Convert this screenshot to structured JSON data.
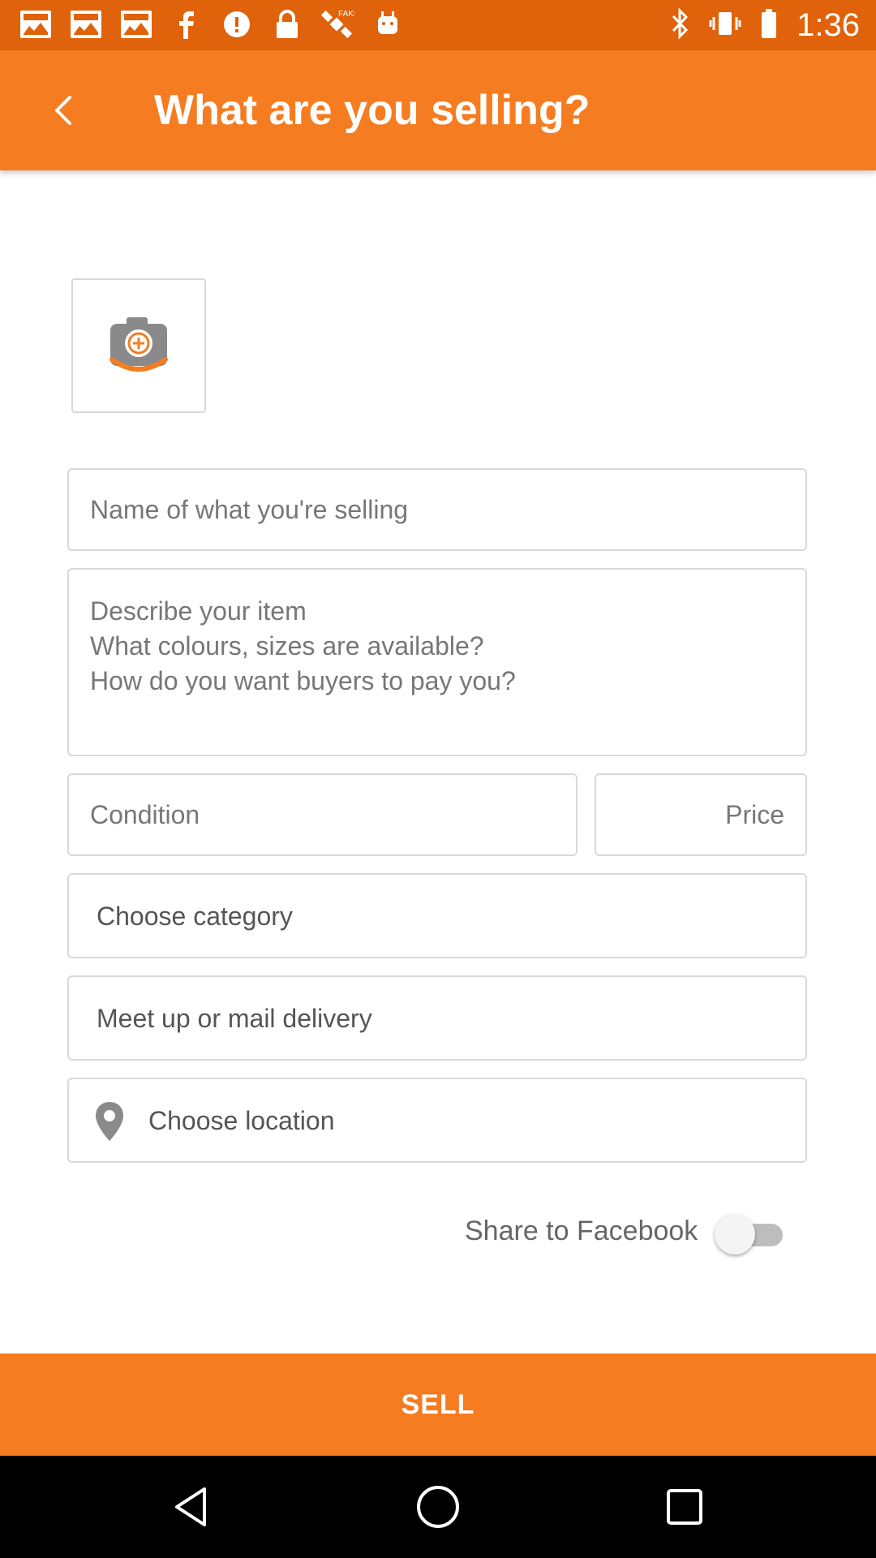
{
  "status_bar": {
    "time": "1:36",
    "left_icons": [
      "app-icon",
      "app-icon",
      "app-icon",
      "facebook-icon",
      "info-icon",
      "lock-icon",
      "satellite-icon",
      "android-icon"
    ],
    "right_icons": [
      "bluetooth-icon",
      "vibrate-icon",
      "battery-icon"
    ],
    "bg": "#e0620a"
  },
  "app_bar": {
    "title": "What are you selling?",
    "bg": "#f57c20"
  },
  "form": {
    "name_placeholder": "Name of what you're selling",
    "description_placeholder": [
      "Describe your item",
      "What colours, sizes are available?",
      "How do you want buyers to pay you?"
    ],
    "condition_placeholder": "Condition",
    "price_placeholder": "Price",
    "category_label": "Choose category",
    "delivery_label": "Meet up or mail delivery",
    "location_label": "Choose location"
  },
  "share": {
    "label": "Share to Facebook",
    "enabled": false
  },
  "sell_button": {
    "label": "SELL"
  },
  "nav_bar": {
    "buttons": [
      "back-triangle-icon",
      "home-circle-icon",
      "recents-square-icon"
    ]
  }
}
